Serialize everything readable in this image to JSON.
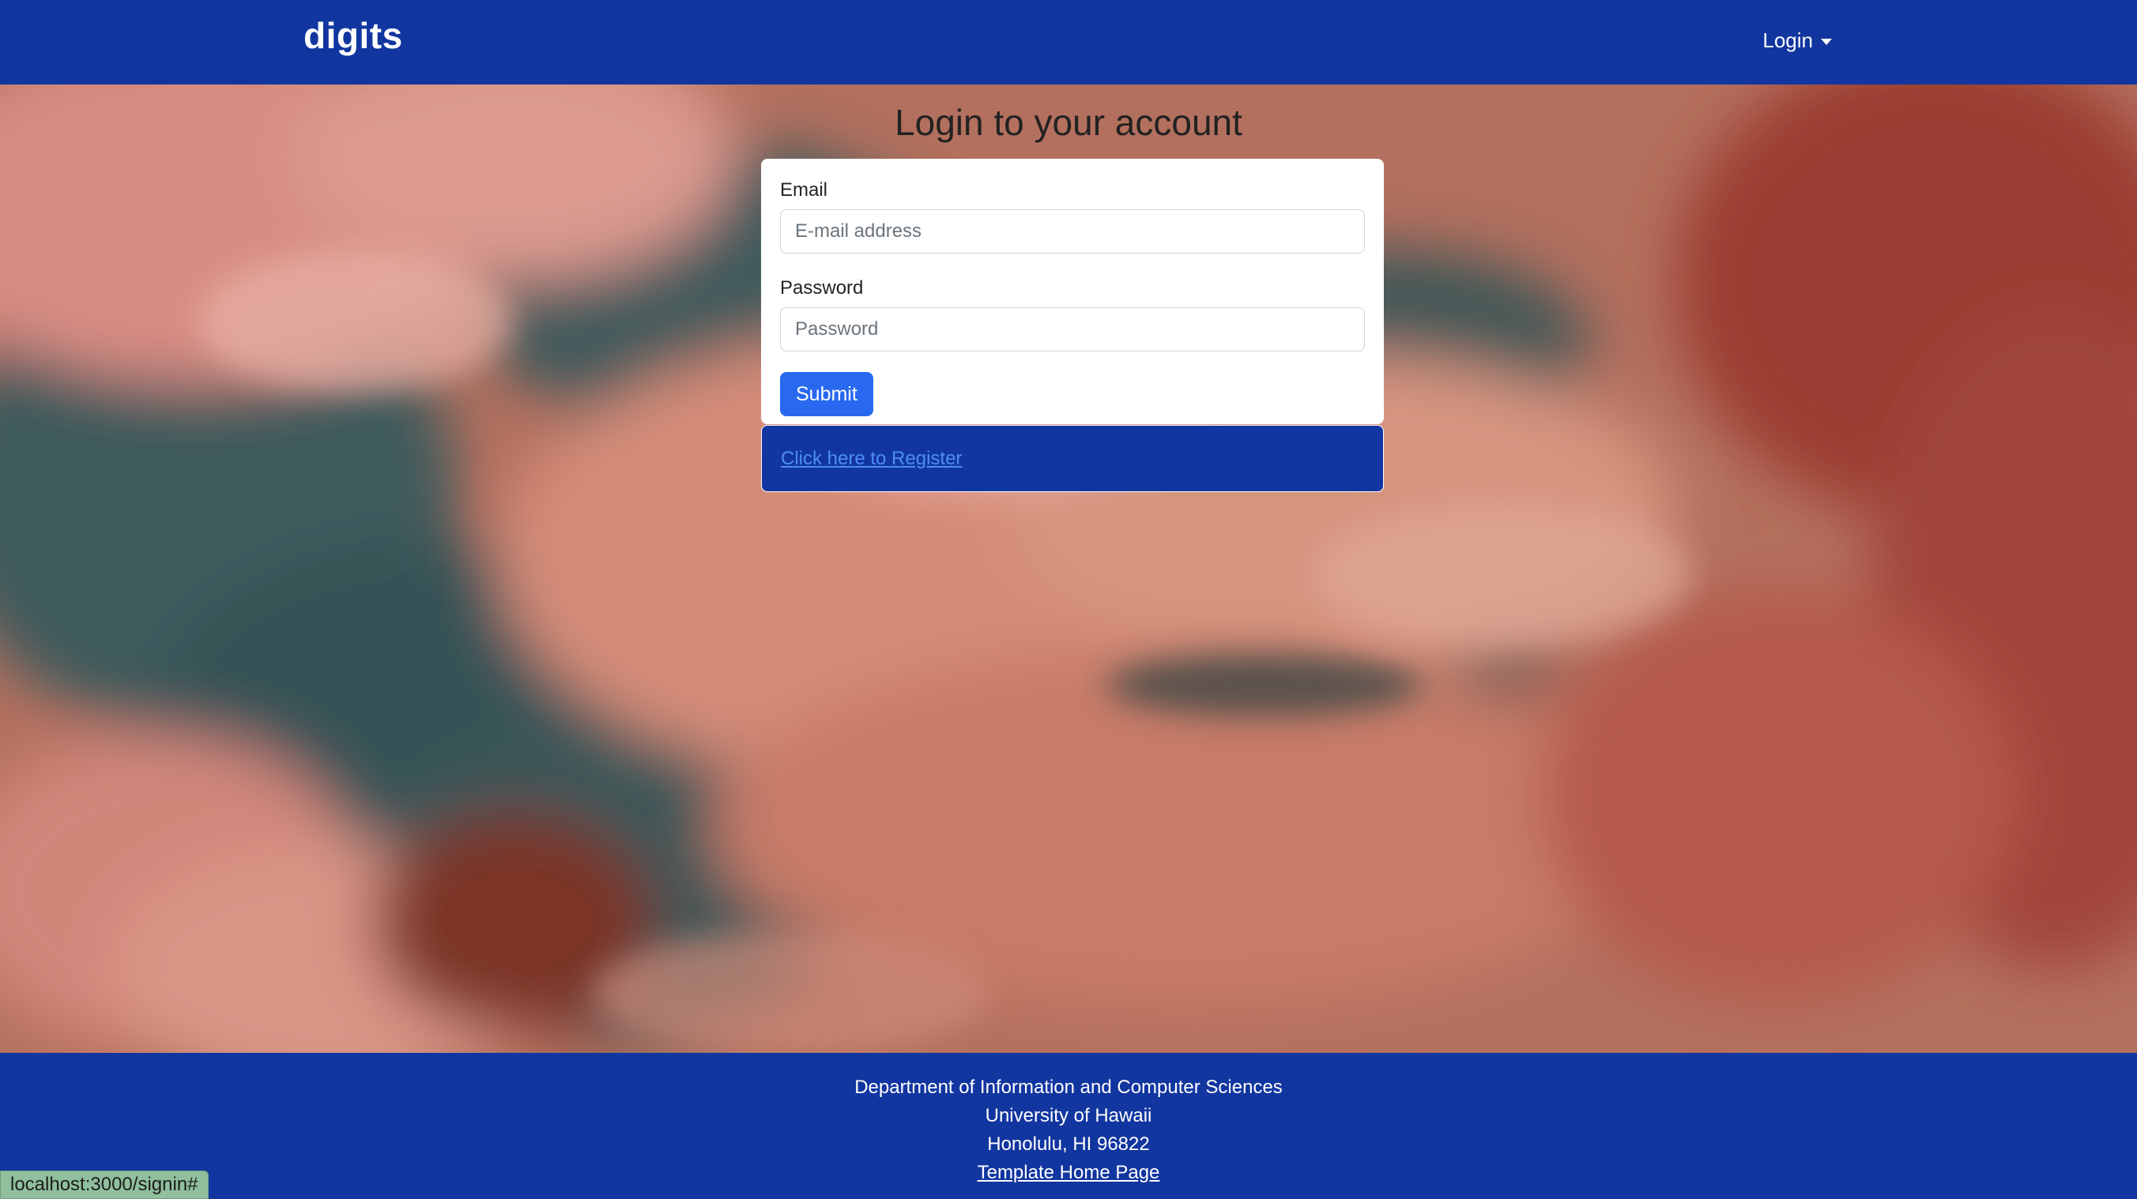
{
  "navbar": {
    "brand": "digits",
    "login_label": "Login"
  },
  "main": {
    "title": "Login to your account",
    "email_label": "Email",
    "email_placeholder": "E-mail address",
    "password_label": "Password",
    "password_placeholder": "Password",
    "submit_label": "Submit",
    "register_link": "Click here to Register"
  },
  "footer": {
    "line1": "Department of Information and Computer Sciences",
    "line2": "University of Hawaii",
    "line3": "Honolulu, HI 96822",
    "link": "Template Home Page"
  },
  "status_bar": {
    "url": "localhost:3000/signin#"
  },
  "colors": {
    "navbar": "#1236a0",
    "primary_button": "#2869f0",
    "link": "#4d8df7"
  }
}
